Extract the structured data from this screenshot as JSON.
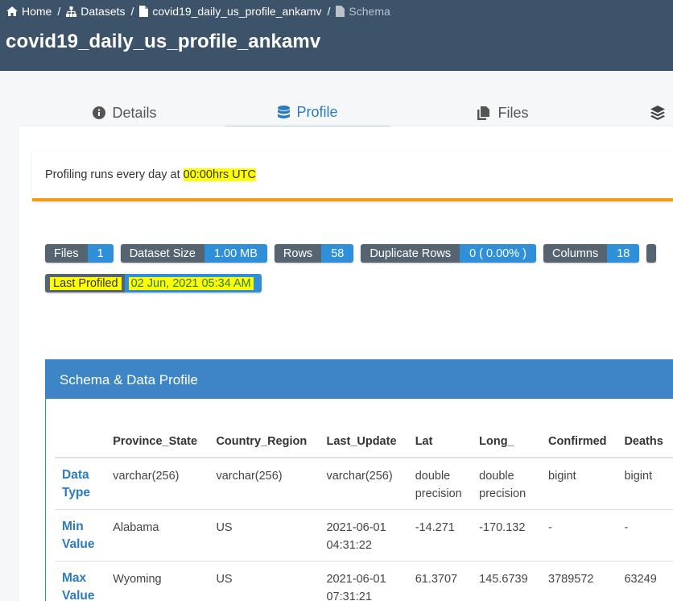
{
  "breadcrumb": {
    "home": "Home",
    "datasets": "Datasets",
    "dataset": "covid19_daily_us_profile_ankamv",
    "current": "Schema"
  },
  "page_title": "covid19_daily_us_profile_ankamv",
  "tabs": [
    {
      "label": "Details",
      "icon": "info-circle-icon"
    },
    {
      "label": "Profile",
      "icon": "database-icon",
      "active": true
    },
    {
      "label": "Files",
      "icon": "files-icon"
    },
    {
      "label": "",
      "icon": "layers-icon"
    }
  ],
  "notice": {
    "prefix": "Profiling runs every day at ",
    "highlight": "00:00hrs UTC"
  },
  "stats": [
    {
      "label": "Files",
      "value": "1"
    },
    {
      "label": "Dataset Size",
      "value": "1.00 MB"
    },
    {
      "label": "Rows",
      "value": "58"
    },
    {
      "label": "Duplicate Rows",
      "value": "0 ( 0.00% )"
    },
    {
      "label": "Columns",
      "value": "18"
    }
  ],
  "last_profiled": {
    "label": "Last Profiled",
    "value": "02 Jun, 2021 05:34 AM"
  },
  "panel_title": "Schema & Data Profile",
  "table": {
    "columns": [
      "Province_State",
      "Country_Region",
      "Last_Update",
      "Lat",
      "Long_",
      "Confirmed",
      "Deaths"
    ],
    "rows": [
      {
        "head": [
          "Data",
          "Type"
        ],
        "cells": [
          [
            "varchar(256)"
          ],
          [
            "varchar(256)"
          ],
          [
            "varchar(256)"
          ],
          [
            "double",
            "precision"
          ],
          [
            "double",
            "precision"
          ],
          [
            "bigint"
          ],
          [
            "bigint"
          ]
        ]
      },
      {
        "head": [
          "Min",
          "Value"
        ],
        "cells": [
          [
            "Alabama"
          ],
          [
            "US"
          ],
          [
            "2021-06-01",
            "04:31:22"
          ],
          [
            "-14.271"
          ],
          [
            "-170.132"
          ],
          [
            "-"
          ],
          [
            "-"
          ]
        ]
      },
      {
        "head": [
          "Max",
          "Value"
        ],
        "cells": [
          [
            "Wyoming"
          ],
          [
            "US"
          ],
          [
            "2021-06-01",
            "07:31:21"
          ],
          [
            "61.3707"
          ],
          [
            "145.6739"
          ],
          [
            "3789572"
          ],
          [
            "63249"
          ]
        ]
      }
    ]
  },
  "colors": {
    "topbar": "#3d5369",
    "accent": "#2b7bc0",
    "badge_key": "#566472",
    "badge_value": "#2f8fd8",
    "notice_border": "#f39c12",
    "highlight": "#ffff00"
  }
}
